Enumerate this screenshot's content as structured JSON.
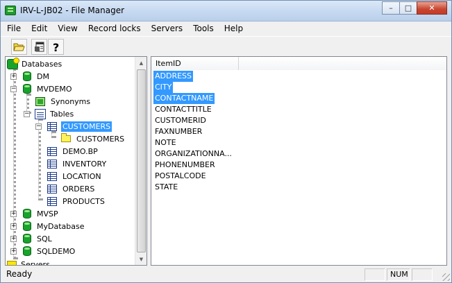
{
  "window": {
    "title": "IRV-L-JB02 - File Manager",
    "controls": {
      "minimize": "–",
      "maximize": "□",
      "close": "✕"
    }
  },
  "menu": [
    "File",
    "Edit",
    "View",
    "Record locks",
    "Servers",
    "Tools",
    "Help"
  ],
  "toolbar": {
    "icons": [
      "open-folder-icon",
      "pane-layout-icon",
      "help-icon"
    ]
  },
  "tree": {
    "root": "Databases",
    "items": [
      {
        "label": "DM",
        "expander": "+"
      },
      {
        "label": "MVDEMO",
        "expander": "−"
      },
      {
        "label": "Synonyms",
        "expander": ""
      },
      {
        "label": "Tables",
        "expander": "−"
      },
      {
        "label": "CUSTOMERS",
        "expander": "−",
        "selected": true
      },
      {
        "label": "CUSTOMERS",
        "expander": ""
      },
      {
        "label": "DEMO.BP",
        "expander": ""
      },
      {
        "label": "INVENTORY",
        "expander": ""
      },
      {
        "label": "LOCATION",
        "expander": ""
      },
      {
        "label": "ORDERS",
        "expander": ""
      },
      {
        "label": "PRODUCTS",
        "expander": ""
      },
      {
        "label": "MVSP",
        "expander": "+"
      },
      {
        "label": "MyDatabase",
        "expander": "+"
      },
      {
        "label": "SQL",
        "expander": "+"
      },
      {
        "label": "SQLDEMO",
        "expander": "+"
      }
    ],
    "servers_label": "Servers"
  },
  "list": {
    "column_header": "ItemID",
    "rows": [
      {
        "label": "ADDRESS",
        "selected": true
      },
      {
        "label": "CITY",
        "selected": true
      },
      {
        "label": "CONTACTNAME",
        "selected": true
      },
      {
        "label": "CONTACTTITLE",
        "selected": false
      },
      {
        "label": "CUSTOMERID",
        "selected": false
      },
      {
        "label": "FAXNUMBER",
        "selected": false
      },
      {
        "label": "NOTE",
        "selected": false
      },
      {
        "label": "ORGANIZATIONNA...",
        "selected": false
      },
      {
        "label": "PHONENUMBER",
        "selected": false
      },
      {
        "label": "POSTALCODE",
        "selected": false
      },
      {
        "label": "STATE",
        "selected": false
      }
    ]
  },
  "status": {
    "text": "Ready",
    "num": "NUM"
  },
  "colors": {
    "selection": "#3399ff",
    "db_green": "#17a32c",
    "table_blue": "#1c3c8c"
  }
}
